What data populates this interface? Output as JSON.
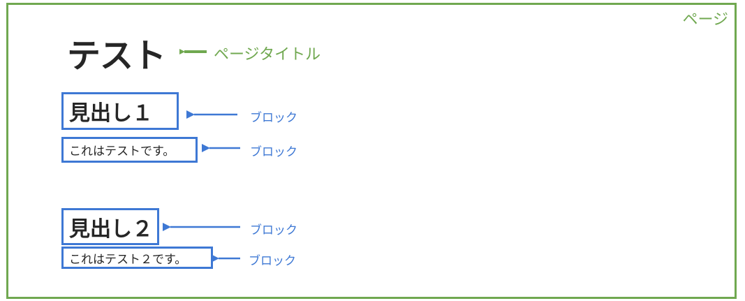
{
  "page": {
    "label": "ページ",
    "title": "テスト",
    "title_annotation": "ページタイトル"
  },
  "blocks": [
    {
      "kind": "heading",
      "text": "見出し１",
      "annotation": "ブロック"
    },
    {
      "kind": "paragraph",
      "text": "これはテストです。",
      "annotation": "ブロック"
    },
    {
      "kind": "heading",
      "text": "見出し２",
      "annotation": "ブロック"
    },
    {
      "kind": "paragraph",
      "text": "これはテスト２です。",
      "annotation": "ブロック"
    }
  ],
  "colors": {
    "page": "#70a850",
    "block": "#3e78d4",
    "text": "#262626"
  }
}
